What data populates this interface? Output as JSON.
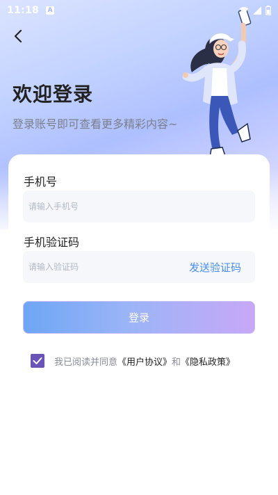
{
  "status_bar": {
    "time": "11:18",
    "a_icon": "A",
    "icons": [
      "notification-a-icon",
      "wifi-icon",
      "signal-icon",
      "battery-icon"
    ]
  },
  "header": {
    "back_icon": "chevron-left-icon",
    "title": "欢迎登录",
    "subtitle": "登录账号即可查看更多精彩内容~"
  },
  "form": {
    "phone_label": "手机号",
    "phone_placeholder": "请输入手机号",
    "phone_value": "",
    "code_label": "手机验证码",
    "code_placeholder": "请输入验证码",
    "code_value": "",
    "send_code_label": "发送验证码",
    "login_label": "登录"
  },
  "agreement": {
    "checked": true,
    "prefix": "我已阅读并同意",
    "user_agreement": "《用户协议》",
    "and": "和",
    "privacy_policy": "《隐私政策》"
  },
  "colors": {
    "accent": "#4a8ef0",
    "checkbox": "#6a54b6",
    "login_gradient_start": "#6ea6f4",
    "login_gradient_end": "#c7a8f7"
  }
}
